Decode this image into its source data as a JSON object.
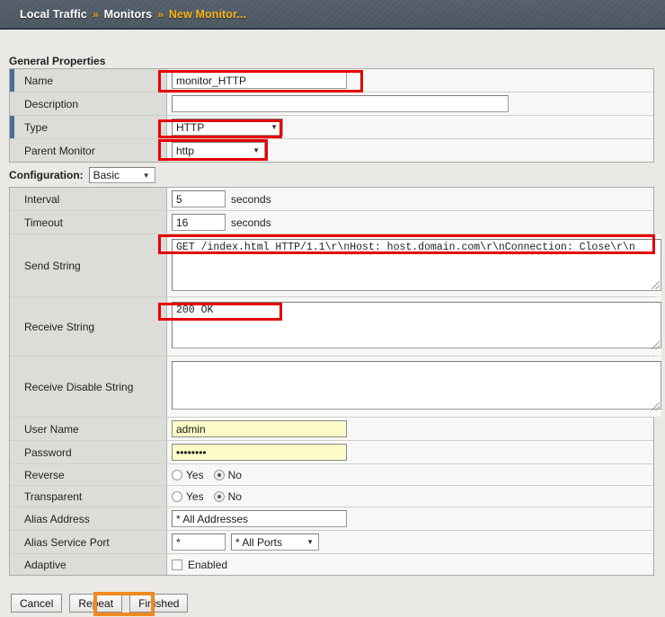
{
  "breadcrumb": {
    "items": [
      "Local Traffic",
      "Monitors",
      "New Monitor..."
    ],
    "separator": "»"
  },
  "general_properties": {
    "title": "General Properties",
    "rows": {
      "name": {
        "label": "Name",
        "value": "monitor_HTTP"
      },
      "description": {
        "label": "Description",
        "value": ""
      },
      "type": {
        "label": "Type",
        "value": "HTTP"
      },
      "parent": {
        "label": "Parent Monitor",
        "value": "http"
      }
    }
  },
  "configuration": {
    "label": "Configuration:",
    "mode": "Basic",
    "rows": {
      "interval": {
        "label": "Interval",
        "value": "5",
        "unit": "seconds"
      },
      "timeout": {
        "label": "Timeout",
        "value": "16",
        "unit": "seconds"
      },
      "send_string": {
        "label": "Send String",
        "value_prefix": "GET /index.html HTTP/1.1\\r\\",
        "value_misspelled_1": "nHost",
        "value_mid": ": host.domain.com\\r\\",
        "value_misspelled_2": "nConnection",
        "value_suffix": ": Close\\r\\n"
      },
      "receive_string": {
        "label": "Receive String",
        "value": "200 OK"
      },
      "receive_disable_string": {
        "label": "Receive Disable String",
        "value": ""
      },
      "user_name": {
        "label": "User Name",
        "value": "admin"
      },
      "password": {
        "label": "Password",
        "value": "••••••••"
      },
      "reverse": {
        "label": "Reverse",
        "yes": "Yes",
        "no": "No",
        "selected": "No"
      },
      "transparent": {
        "label": "Transparent",
        "yes": "Yes",
        "no": "No",
        "selected": "No"
      },
      "alias_address": {
        "label": "Alias Address",
        "value": "* All Addresses"
      },
      "alias_service_port": {
        "label": "Alias Service Port",
        "value": "*",
        "select_value": "* All Ports"
      },
      "adaptive": {
        "label": "Adaptive",
        "checkbox_label": "Enabled",
        "checked": false
      }
    }
  },
  "footer": {
    "cancel": "Cancel",
    "repeat": "Repeat",
    "finished": "Finished"
  },
  "colors": {
    "header_bar": "#4a5661",
    "breadcrumb_current": "#fcb415",
    "breadcrumb_separator": "#f0a500",
    "page_background": "#eae9e5",
    "label_cell": "#dcdcd8",
    "required_marker": "#4a6f94",
    "autofill_field": "#fcfcc8",
    "annotation_red": "#e60000",
    "annotation_orange": "#ef8a22"
  }
}
